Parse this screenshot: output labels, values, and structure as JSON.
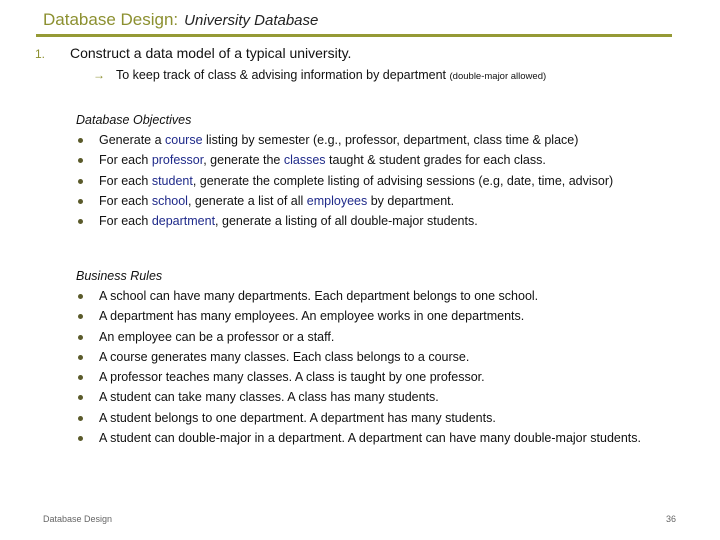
{
  "title": {
    "main": "Database Design:",
    "sub": "University Database"
  },
  "accent_color": "#959a35",
  "item": {
    "number": "1.",
    "text": "Construct a data model of a typical university.",
    "arrow_icon": "right-arrow",
    "sub_text": "To keep track of class & advising information by department",
    "sub_note": "(double-major allowed)"
  },
  "objectives": {
    "heading": "Database Objectives",
    "items": [
      {
        "pre": "Generate a ",
        "hl": "course",
        "post": " listing by semester (e.g., professor, department, class time & place)"
      },
      {
        "pre": "For each ",
        "hl": "professor",
        "mid": ", generate the ",
        "hl2": "classes",
        "post": " taught & student grades for each class."
      },
      {
        "pre": "For each ",
        "hl": "student",
        "post": ", generate the complete listing of advising sessions (e.g, date, time, advisor)"
      },
      {
        "pre": "For each ",
        "hl": "school",
        "mid": ", generate a list of all ",
        "hl2": "employees",
        "post": " by department."
      },
      {
        "pre": "For each ",
        "hl": "department",
        "post": ", generate a listing of all double-major students."
      }
    ]
  },
  "rules": {
    "heading": "Business Rules",
    "items": [
      "A school can have many departments.  Each department belongs to one school.",
      "A department has many employees.  An employee works in one departments.",
      "An employee can be a professor or a staff.",
      "A course generates many classes. Each class belongs to a course.",
      "A professor teaches many classes. A class is taught  by one professor.",
      "A student can take many classes.  A class has many students.",
      "A student belongs to one department.  A department has many students.",
      "A student can double-major in a department.  A department can have many double-major students."
    ]
  },
  "footer": {
    "left": "Database Design",
    "page": "36"
  }
}
